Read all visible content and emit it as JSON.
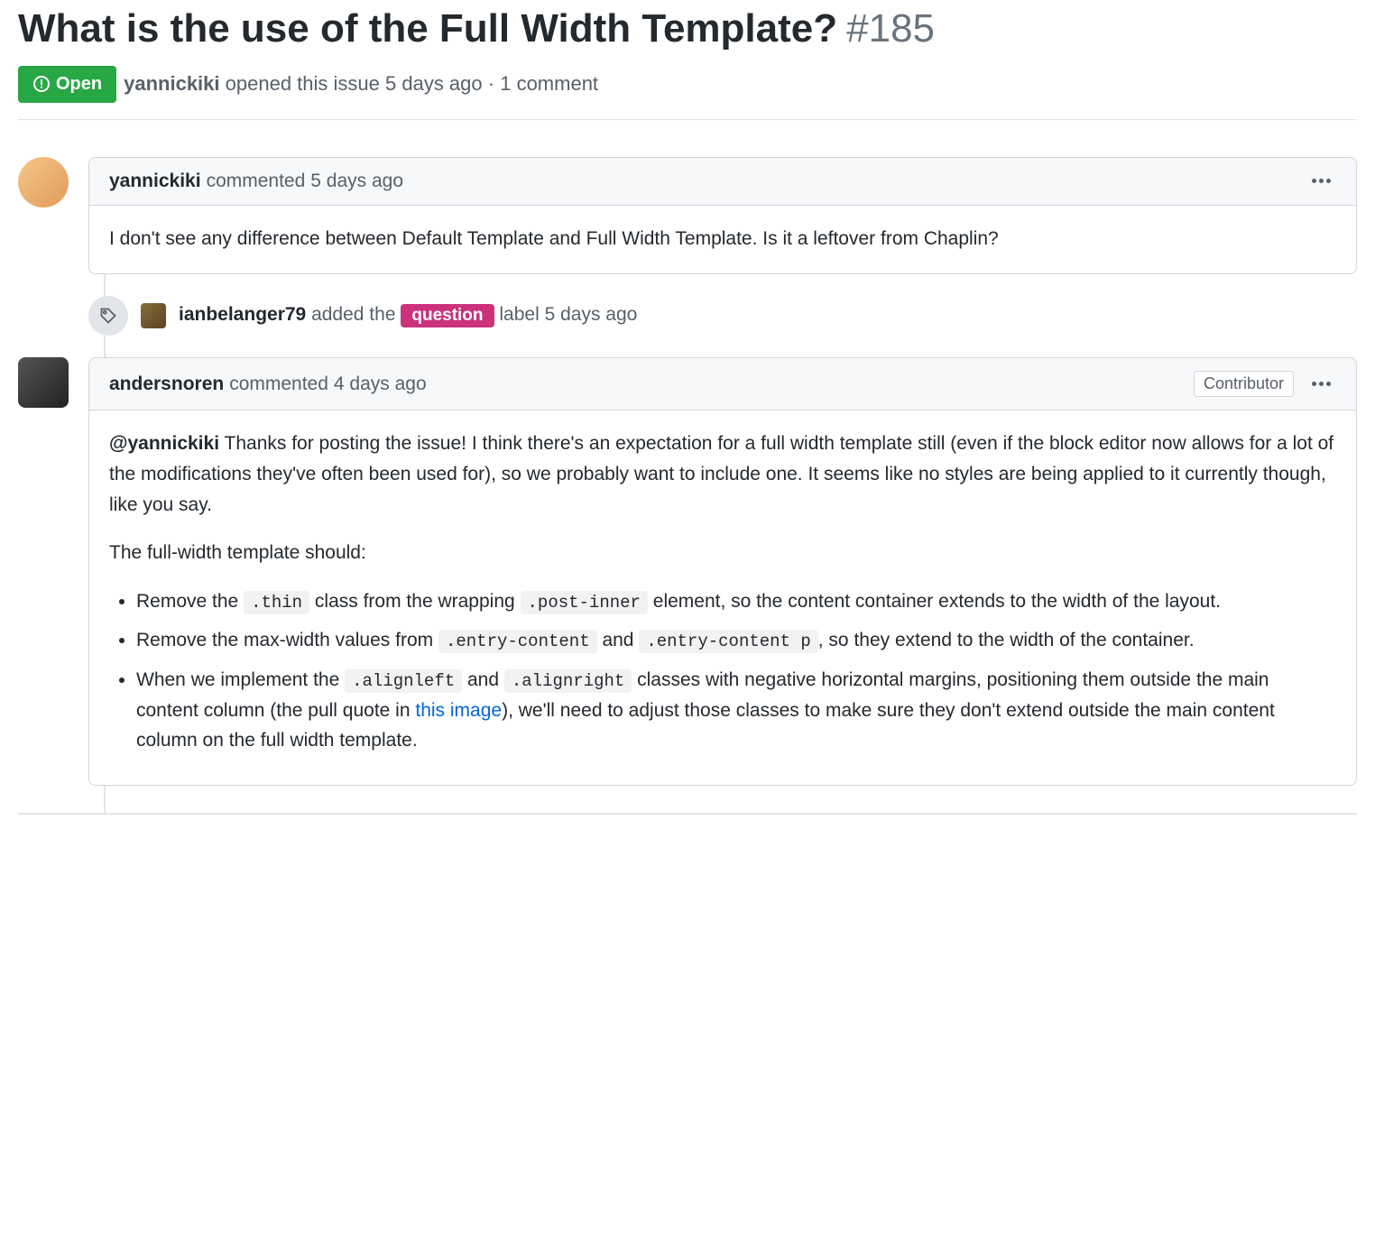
{
  "issue": {
    "title": "What is the use of the Full Width Template?",
    "number": "#185",
    "state": "Open",
    "opened_by": "yannickiki",
    "opened_text_prefix": "opened this issue",
    "opened_time": "5 days ago",
    "comment_count_text": "1 comment"
  },
  "comments": [
    {
      "author": "yannickiki",
      "action": "commented",
      "time": "5 days ago",
      "role": null,
      "body_plain": "I don't see any difference between Default Template and Full Width Template. Is it a leftover from Chaplin?"
    },
    {
      "author": "andersnoren",
      "action": "commented",
      "time": "4 days ago",
      "role": "Contributor",
      "mention": "@yannickiki",
      "p1_after_mention": " Thanks for posting the issue! I think there's an expectation for a full width template still (even if the block editor now allows for a lot of the modifications they've often been used for), so we probably want to include one. It seems like no styles are being applied to it currently though, like you say.",
      "p2": "The full-width template should:",
      "li1_a": "Remove the ",
      "li1_code1": ".thin",
      "li1_b": " class from the wrapping ",
      "li1_code2": ".post-inner",
      "li1_c": " element, so the content container extends to the width of the layout.",
      "li2_a": "Remove the max-width values from ",
      "li2_code1": ".entry-content",
      "li2_b": " and ",
      "li2_code2": ".entry-content p",
      "li2_c": ", so they extend to the width of the container.",
      "li3_a": "When we implement the ",
      "li3_code1": ".alignleft",
      "li3_b": " and ",
      "li3_code2": ".alignright",
      "li3_c": " classes with negative horizontal margins, positioning them outside the main content column (the pull quote in ",
      "li3_link": "this image",
      "li3_d": "), we'll need to adjust those classes to make sure they don't extend outside the main content column on the full width template."
    }
  ],
  "event": {
    "actor": "ianbelanger79",
    "text_before": "added the",
    "label": "question",
    "text_after": "label",
    "time": "5 days ago"
  },
  "colors": {
    "label_bg": "#cc317c",
    "open_bg": "#28a745",
    "link": "#0366d6"
  }
}
